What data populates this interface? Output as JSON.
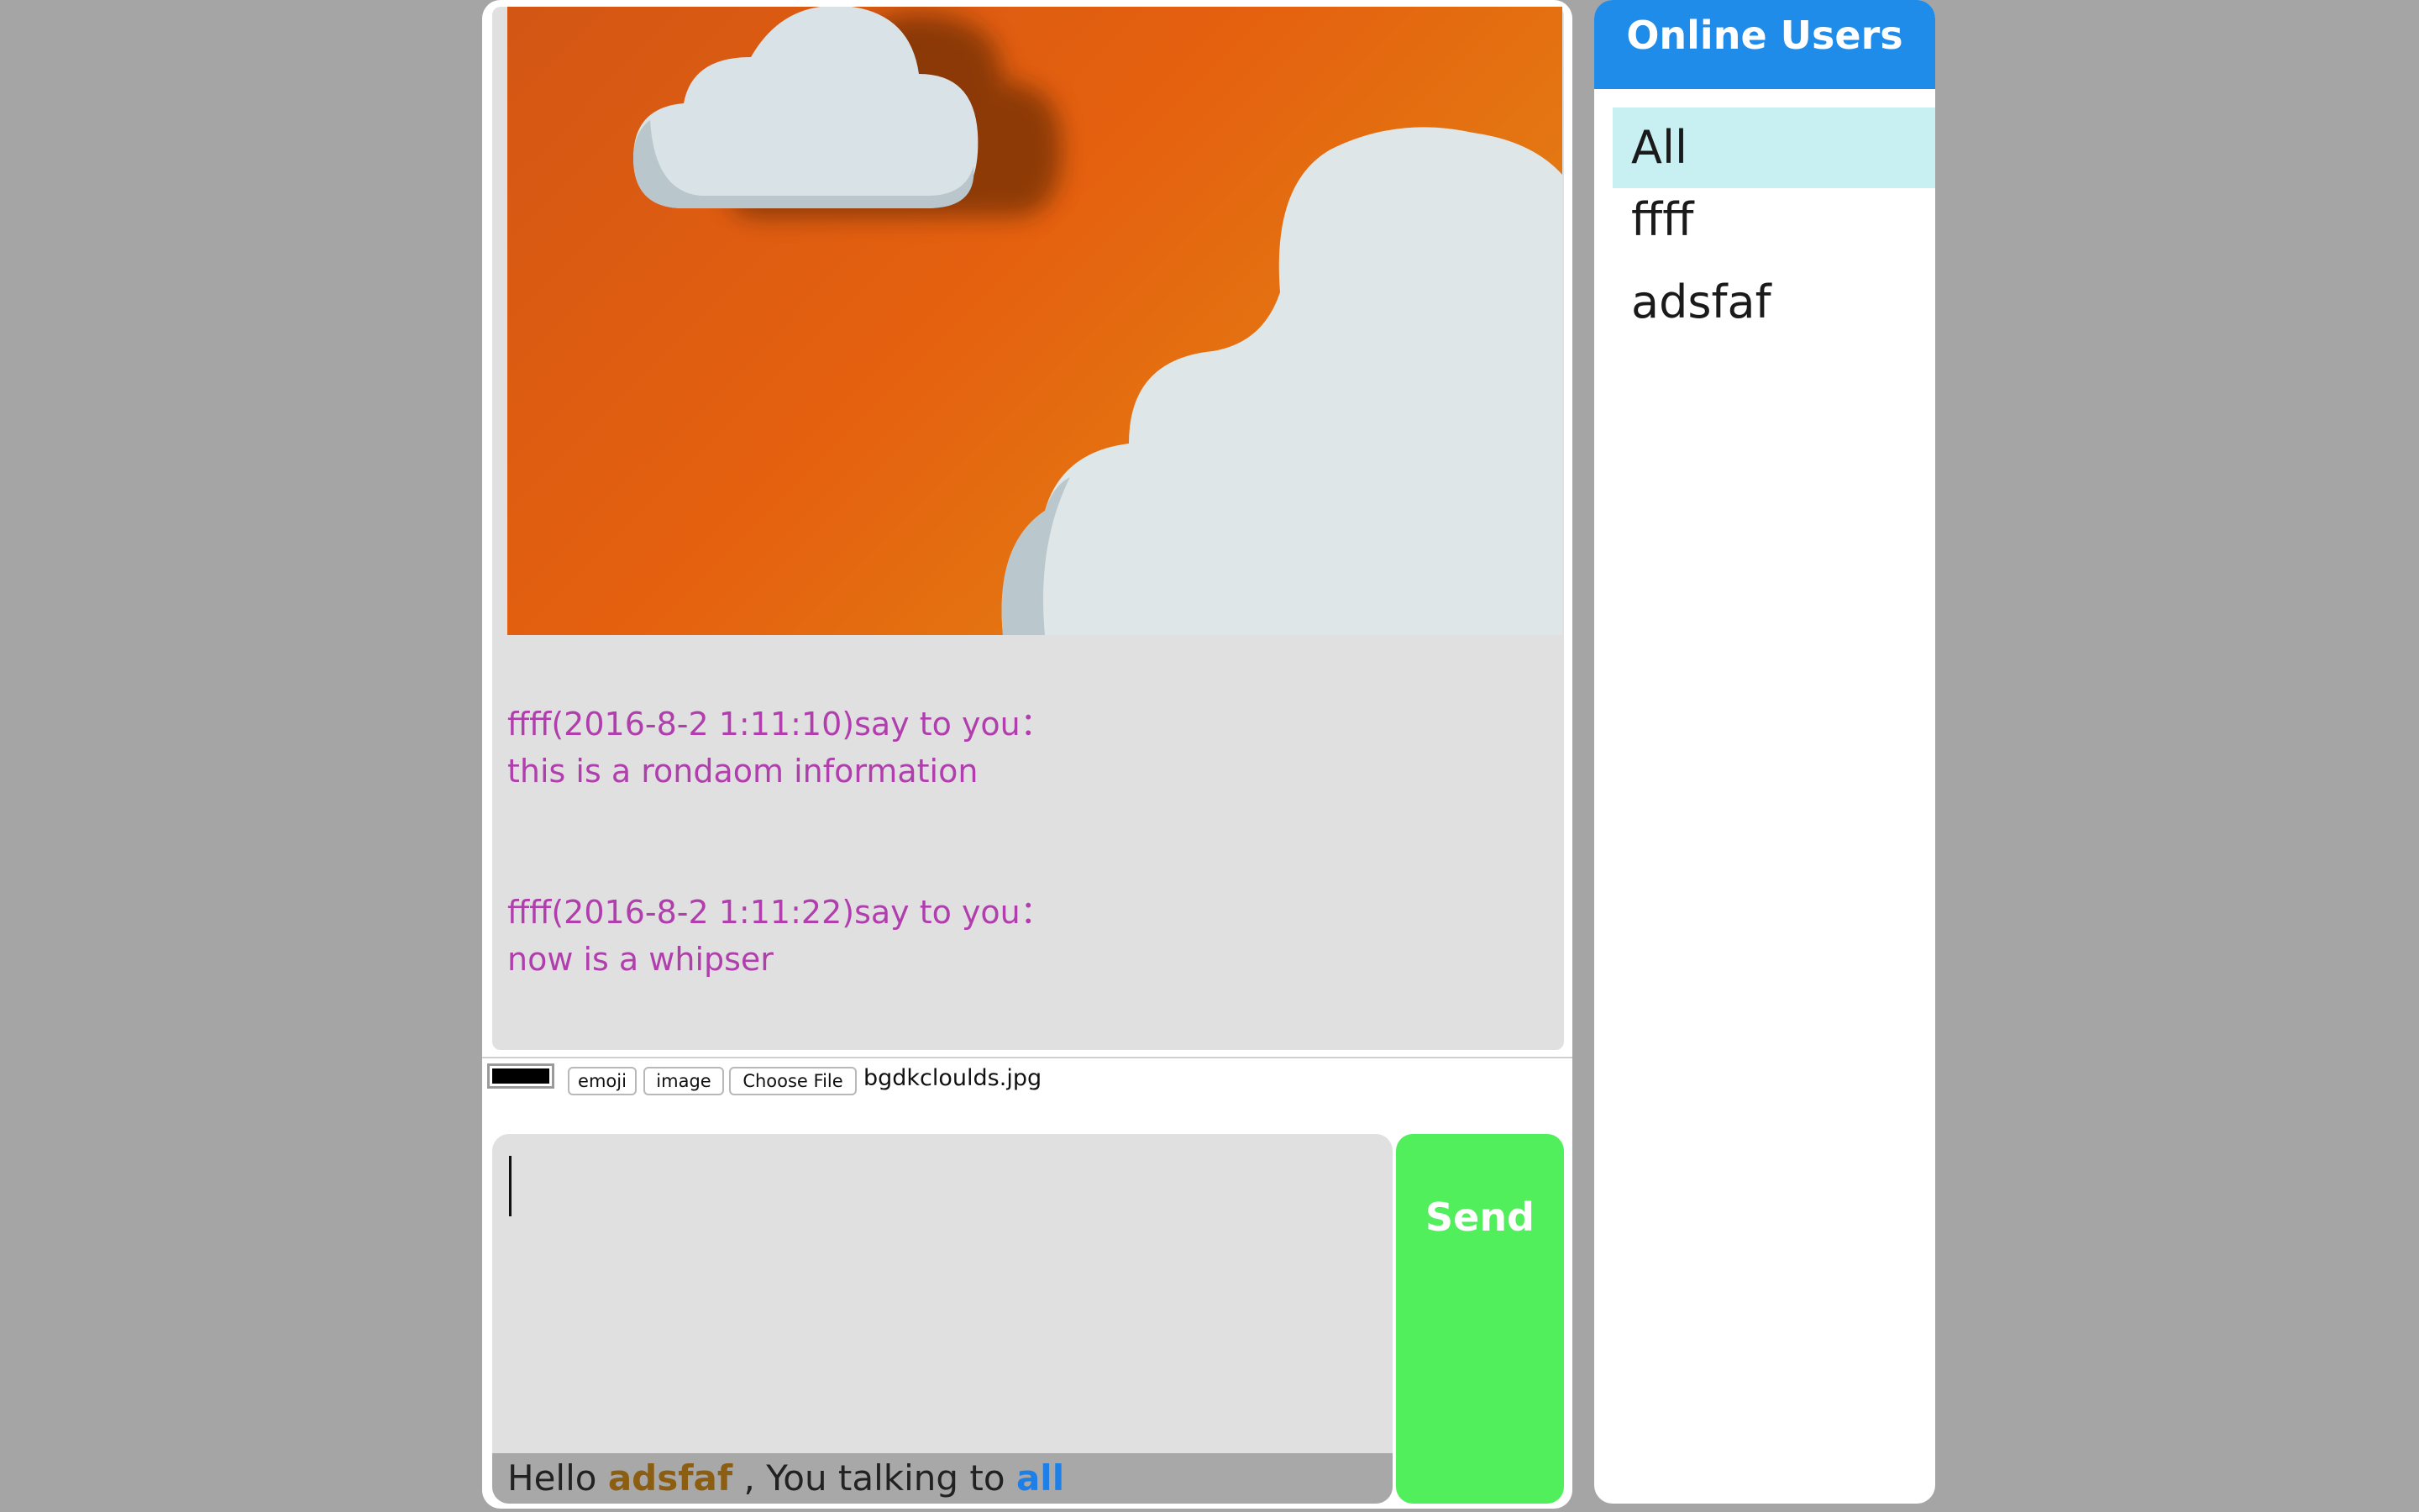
{
  "chat": {
    "shared_image_name": "orange-clouds-image",
    "messages": [
      {
        "header": "ffff(2016-8-2 1:11:10)say to you：",
        "body": "this is a rondaom information"
      },
      {
        "header": "ffff(2016-8-2 1:11:22)say to you：",
        "body": "now is a whipser"
      }
    ],
    "message_color": "#b03fad"
  },
  "toolbar": {
    "color_value": "#000000",
    "emoji_label": "emoji",
    "image_label": "image",
    "choose_file_label": "Choose File",
    "file_name": "bgdkcloulds.jpg"
  },
  "composer": {
    "input_value": "",
    "send_label": "Send",
    "send_color": "#52ef5d"
  },
  "status": {
    "greeting": "Hello",
    "username": "adsfaf",
    "separator": " ,   ",
    "talking_to_label": "You talking to",
    "target": "all"
  },
  "users_panel": {
    "title": "Online Users",
    "header_color": "#1f8cea",
    "users": [
      {
        "name": "All",
        "selected": true
      },
      {
        "name": "ffff",
        "selected": false
      },
      {
        "name": "adsfaf",
        "selected": false
      }
    ]
  }
}
